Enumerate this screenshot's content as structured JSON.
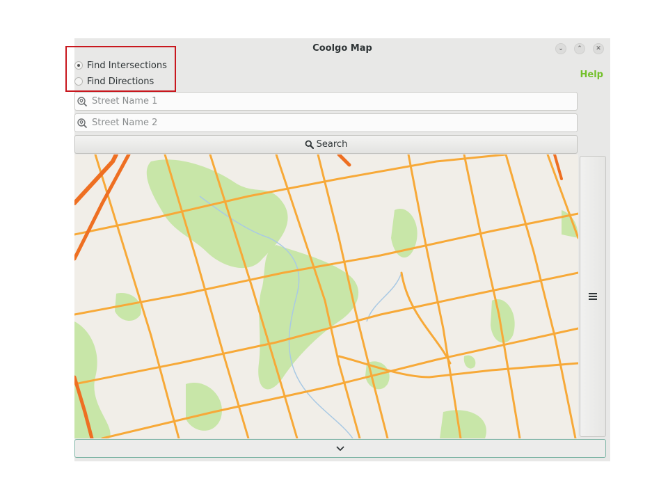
{
  "window": {
    "title": "Coolgo Map"
  },
  "titlebar_buttons": {
    "minimize": "⌄",
    "maximize": "⌃",
    "close": "✕"
  },
  "mode": {
    "options": [
      {
        "label": "Find Intersections",
        "selected": true
      },
      {
        "label": "Find Directions",
        "selected": false
      }
    ]
  },
  "help": {
    "label": "Help",
    "color": "#73c02a"
  },
  "inputs": {
    "street1": {
      "value": "",
      "placeholder": "Street Name 1"
    },
    "street2": {
      "value": "",
      "placeholder": "Street Name 2"
    }
  },
  "search": {
    "label": "Search",
    "icon": "search-icon"
  },
  "map": {
    "colors": {
      "background": "#f1eee8",
      "park": "#c8e6a8",
      "road_major": "#f7a938",
      "highway": "#ee6f22",
      "water": "#a9c9e4"
    }
  },
  "side_panel": {
    "icon": "hamburger-menu-icon"
  },
  "bottom_panel": {
    "icon": "chevron-down-icon"
  },
  "annotation": {
    "highlight_color": "#c8171e"
  }
}
